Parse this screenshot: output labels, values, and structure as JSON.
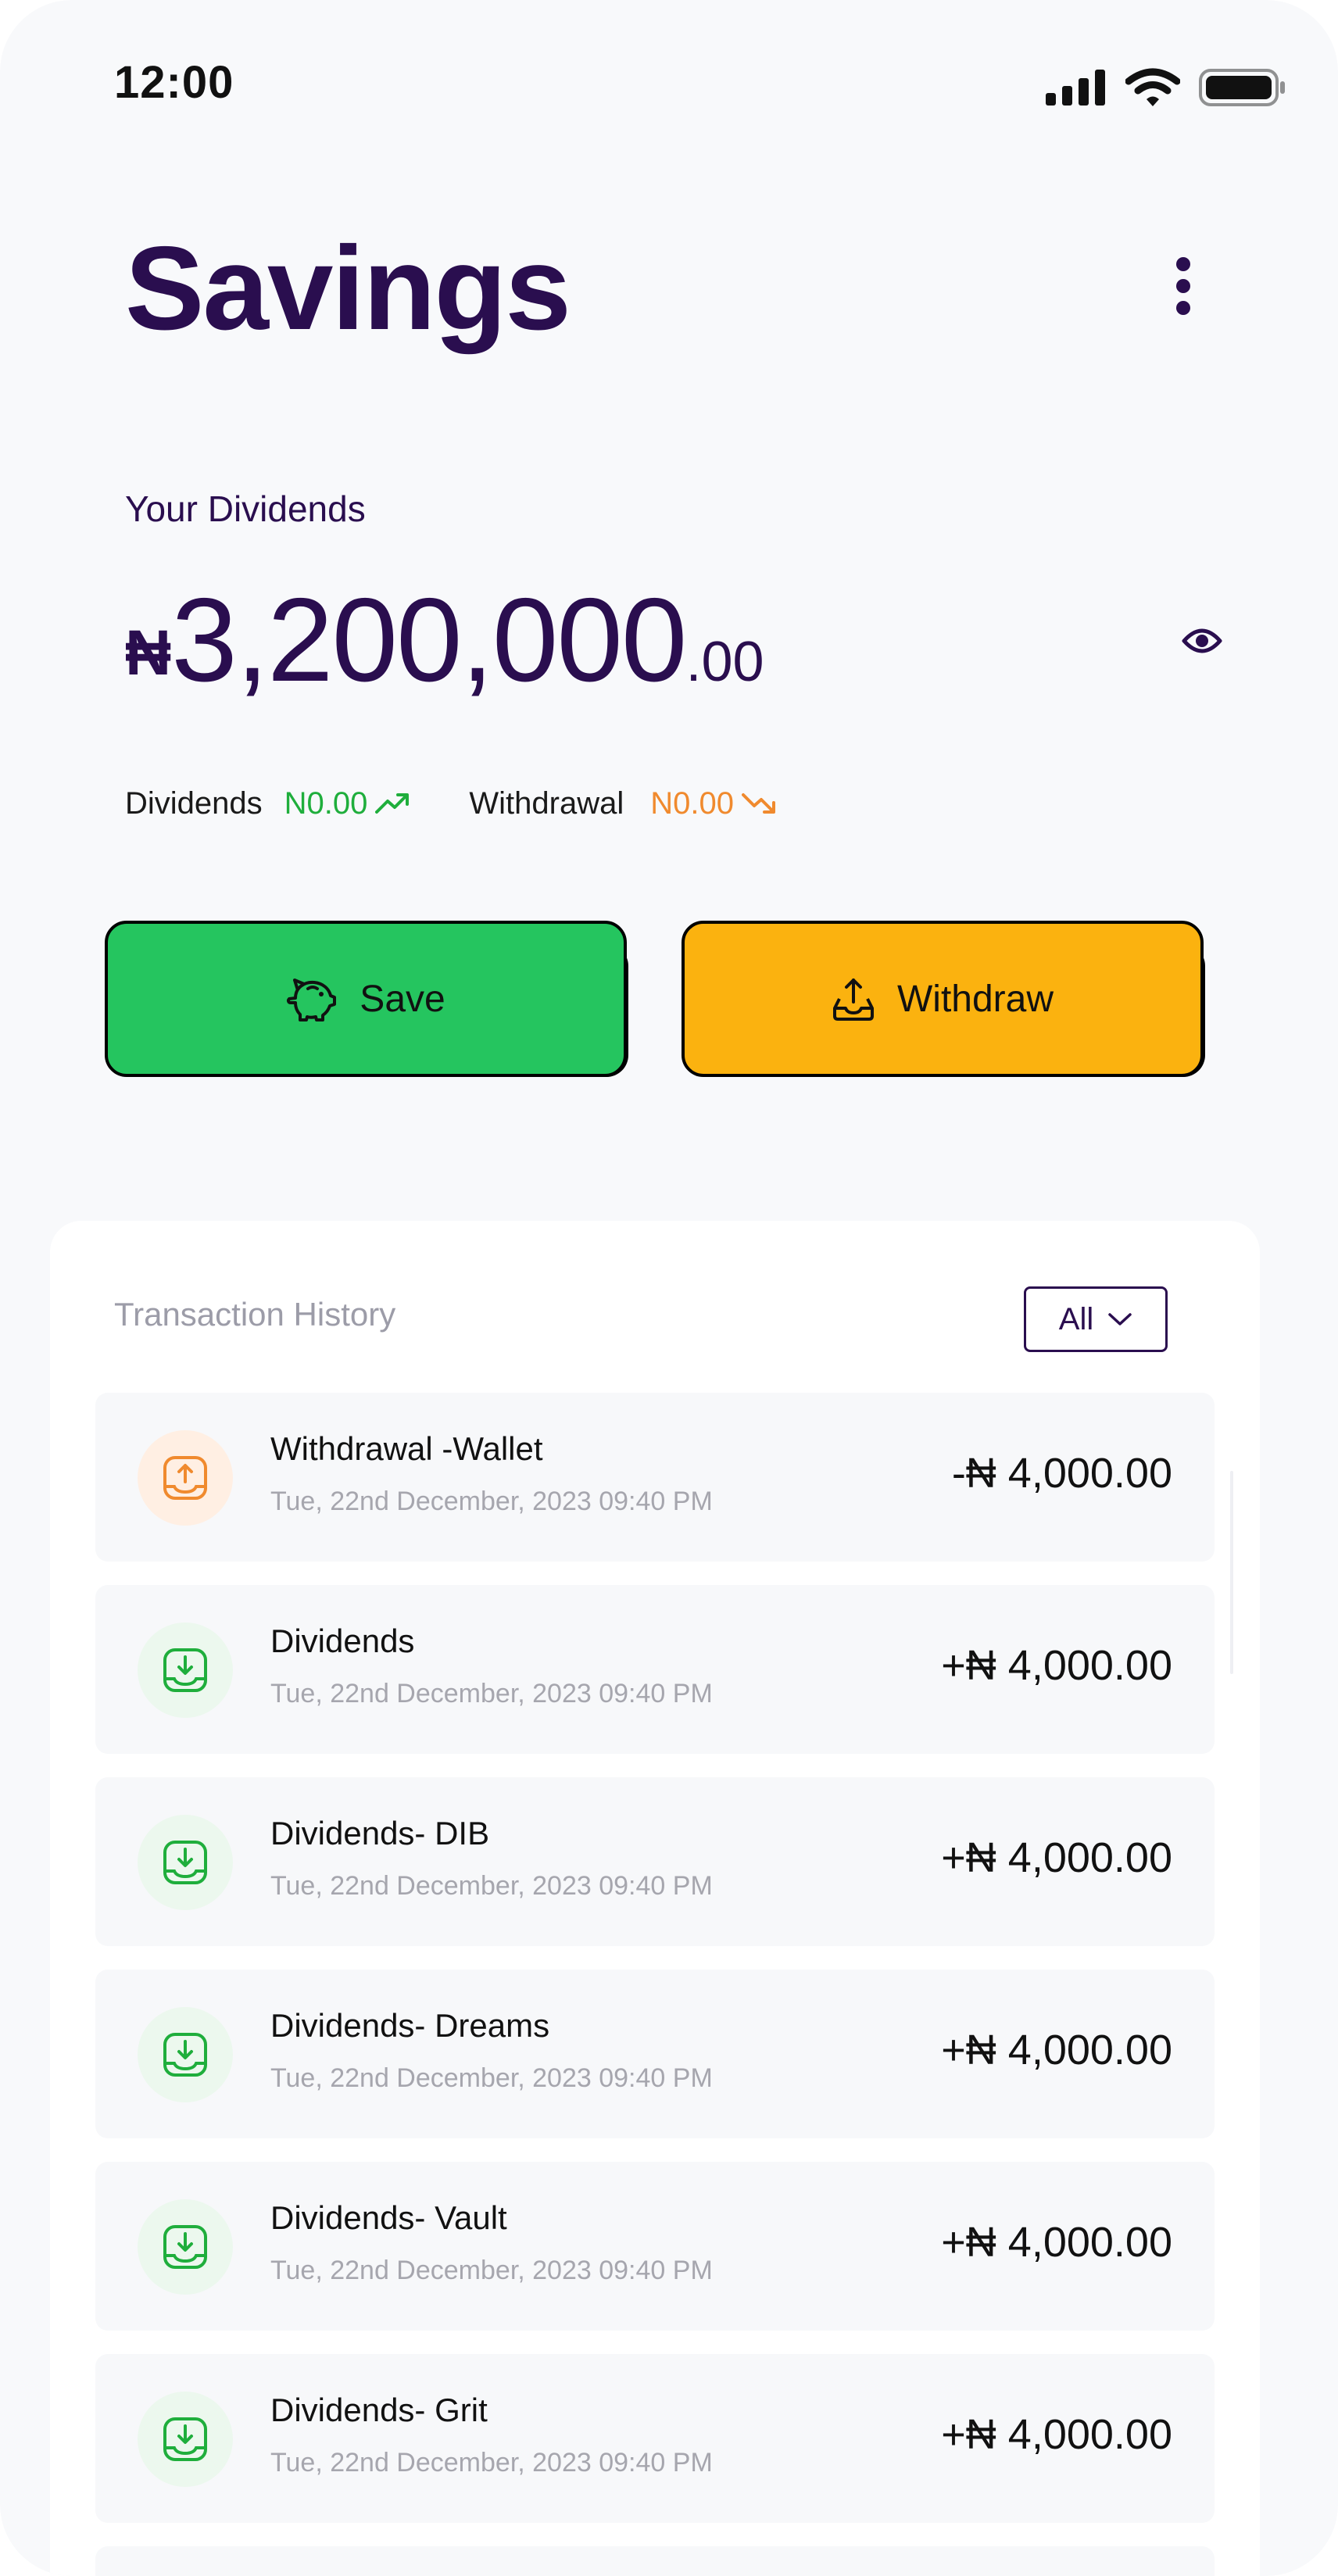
{
  "status_bar": {
    "time": "12:00"
  },
  "header": {
    "title": "Savings"
  },
  "balance": {
    "label": "Your Dividends",
    "currency": "₦",
    "amount": "3,200,000",
    "decimals": ".00"
  },
  "stats": {
    "dividends_label": "Dividends",
    "dividends_value": "N0.00",
    "withdrawal_label": "Withdrawal",
    "withdrawal_value": "N0.00"
  },
  "actions": {
    "save_label": "Save",
    "withdraw_label": "Withdraw"
  },
  "history": {
    "title": "Transaction History",
    "filter_value": "All",
    "items": [
      {
        "name": "Withdrawal -Wallet",
        "date": "Tue, 22nd December, 2023 09:40 PM",
        "amount": "-₦ 4,000.00",
        "type": "outflow"
      },
      {
        "name": "Dividends",
        "date": "Tue, 22nd December, 2023 09:40 PM",
        "amount": "+₦ 4,000.00",
        "type": "inflow"
      },
      {
        "name": "Dividends- DIB",
        "date": "Tue, 22nd December, 2023 09:40 PM",
        "amount": "+₦ 4,000.00",
        "type": "inflow"
      },
      {
        "name": "Dividends- Dreams",
        "date": "Tue, 22nd December, 2023 09:40 PM",
        "amount": "+₦ 4,000.00",
        "type": "inflow"
      },
      {
        "name": "Dividends- Vault",
        "date": "Tue, 22nd December, 2023 09:40 PM",
        "amount": "+₦ 4,000.00",
        "type": "inflow"
      },
      {
        "name": "Dividends- Grit",
        "date": "Tue, 22nd December, 2023 09:40 PM",
        "amount": "+₦ 4,000.00",
        "type": "inflow"
      }
    ]
  },
  "colors": {
    "primary": "#2A0E4F",
    "save_green": "#25C55F",
    "withdraw_yellow": "#FBB20F",
    "positive": "#1FAE3C",
    "negative": "#F08A2E",
    "background": "#F8F9FB"
  },
  "icons": [
    "signal-icon",
    "wifi-icon",
    "battery-icon",
    "kebab-menu-icon",
    "eye-icon",
    "trend-up-icon",
    "trend-down-icon",
    "piggy-bank-icon",
    "withdraw-icon",
    "chevron-down-icon",
    "upload-icon",
    "download-icon"
  ]
}
